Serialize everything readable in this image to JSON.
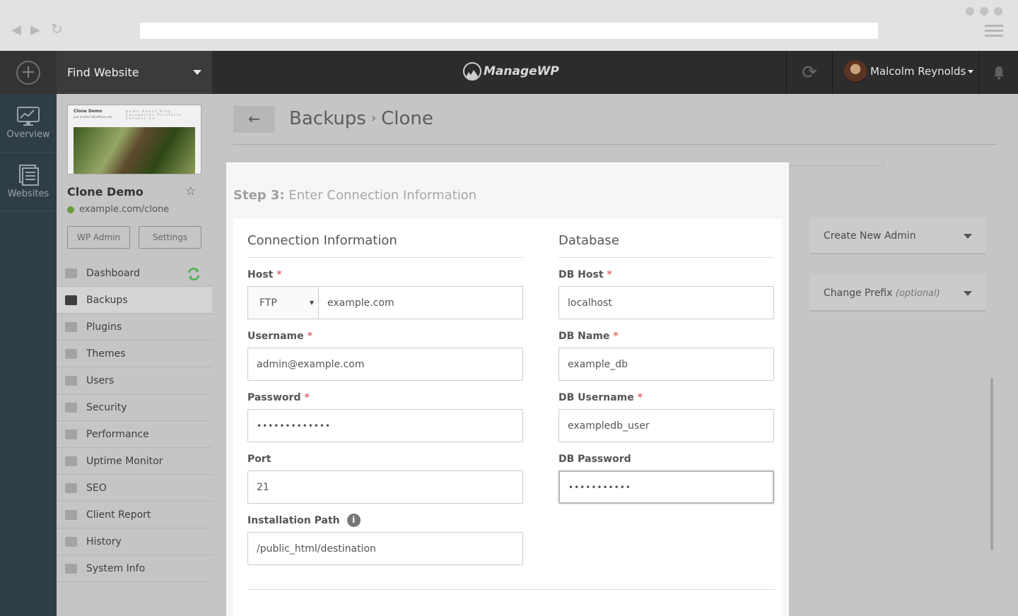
{
  "browser": {
    "back_icon": "back-arrow-icon",
    "forward_icon": "forward-arrow-icon",
    "reload_icon": "reload-icon",
    "menu_icon": "hamburger-icon"
  },
  "topbar": {
    "find_website": "Find Website",
    "brand": "ManageWP",
    "user_name": "Malcolm Reynolds"
  },
  "rail": [
    {
      "label": "Overview",
      "icon": "chart-monitor-icon"
    },
    {
      "label": "Websites",
      "icon": "pages-icon"
    }
  ],
  "site": {
    "thumb_title": "Clone Demo",
    "thumb_subtitle": "Just another WordPress site",
    "thumb_nav": "Home About Blog Categories Portfolio Contact Us",
    "name": "Clone Demo",
    "url": "example.com/clone",
    "wp_admin": "WP Admin",
    "settings": "Settings"
  },
  "menu": [
    {
      "label": "Dashboard",
      "icon": "monitor-icon"
    },
    {
      "label": "Backups",
      "icon": "backup-icon",
      "active": true
    },
    {
      "label": "Plugins",
      "icon": "plug-icon"
    },
    {
      "label": "Themes",
      "icon": "palette-icon"
    },
    {
      "label": "Users",
      "icon": "user-icon"
    },
    {
      "label": "Security",
      "icon": "shield-icon"
    },
    {
      "label": "Performance",
      "icon": "gauge-icon"
    },
    {
      "label": "Uptime Monitor",
      "icon": "up-arrow-icon"
    },
    {
      "label": "SEO",
      "icon": "megaphone-icon"
    },
    {
      "label": "Client Report",
      "icon": "report-icon"
    },
    {
      "label": "History",
      "icon": "clock-icon"
    },
    {
      "label": "System Info",
      "icon": "server-icon"
    }
  ],
  "breadcrumb": {
    "level1": "Backups",
    "sep": "›",
    "level2": "Clone",
    "back": "←"
  },
  "step": {
    "prefix": "Step 3:",
    "title": "Enter Connection Information"
  },
  "connection": {
    "heading": "Connection Information",
    "host_label": "Host",
    "host_protocol": "FTP",
    "host_value": "example.com",
    "username_label": "Username",
    "username_value": "admin@example.com",
    "password_label": "Password",
    "password_value": "•••••••••••••",
    "port_label": "Port",
    "port_value": "21",
    "path_label": "Installation Path",
    "path_value": "/public_html/destination"
  },
  "database": {
    "heading": "Database",
    "host_label": "DB Host",
    "host_value": "localhost",
    "name_label": "DB Name",
    "name_value": "example_db",
    "username_label": "DB Username",
    "username_value": "exampledb_user",
    "password_label": "DB Password",
    "password_value": "•••••••••••"
  },
  "options": {
    "create_admin": "Create New Admin",
    "change_prefix": "Change Prefix",
    "change_prefix_hint": "(optional)"
  },
  "required_mark": "*",
  "colors": {
    "sidebar_bg": "#c5c5c5",
    "rail_bg": "#2f3d46",
    "topbar_bg": "#2c2c2c",
    "required": "#e26a6a",
    "sync_green": "#4caf50"
  }
}
